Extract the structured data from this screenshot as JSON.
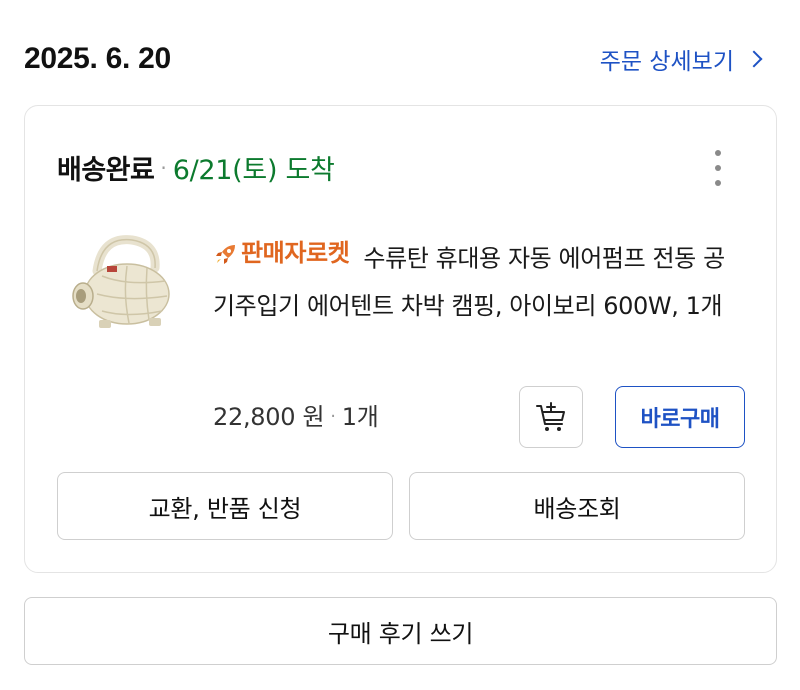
{
  "order": {
    "date": "2025. 6. 20",
    "detail_link_label": "주문 상세보기"
  },
  "delivery": {
    "status": "배송완료",
    "separator": "·",
    "arrival": "6/21(토) 도착"
  },
  "product": {
    "seller_badge": "판매자로켓",
    "name": "수류탄 휴대용 자동 에어펌프 전동 공기주입기 에어텐트 차박 캠핑, 아이보리 600W, 1개",
    "price": "22,800 원",
    "price_separator": "·",
    "quantity": "1개",
    "image_icon": "air-pump-image"
  },
  "buttons": {
    "cart_icon": "add-to-cart-icon",
    "buy_now": "바로구매",
    "exchange_return": "교환, 반품 신청",
    "track_delivery": "배송조회",
    "write_review": "구매 후기 쓰기"
  },
  "colors": {
    "link_blue": "#1e52c4",
    "arrival_green": "#0c7a2e",
    "rocket_orange": "#e0661f"
  }
}
